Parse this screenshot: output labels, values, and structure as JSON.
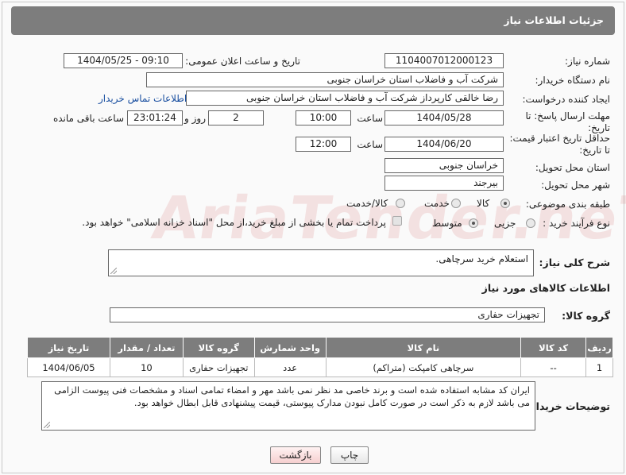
{
  "page_title": "جزئیات اطلاعات نیاز",
  "watermark_text": "AriaTender.neT",
  "fields": {
    "need_number_label": "شماره نیاز:",
    "need_number": "1104007012000123",
    "announce_label": "تاریخ و ساعت اعلان عمومی:",
    "announce_value": "1404/05/25 - 09:10",
    "buyer_org_label": "نام دستگاه خریدار:",
    "buyer_org": "شرکت آب و فاضلاب استان خراسان جنوبی",
    "creator_label": "ایجاد کننده درخواست:",
    "creator": "رضا خالقی کارپرداز شرکت آب و فاضلاب استان خراسان جنوبی",
    "contact_link": "اطلاعات تماس خریدار",
    "reply_deadline_label_1": "مهلت ارسال پاسخ: تا",
    "reply_deadline_label_2": "تاریخ:",
    "reply_date": "1404/05/28",
    "time_label": "ساعت",
    "reply_time": "10:00",
    "days_value": "2",
    "days_label": "روز و",
    "remaining_time": "23:01:24",
    "remaining_label": "ساعت باقی مانده",
    "price_deadline_label_1": "حداقل تاریخ اعتبار قیمت:",
    "price_deadline_label_2": "تا تاریخ:",
    "price_date": "1404/06/20",
    "price_time": "12:00",
    "province_label": "استان محل تحویل:",
    "province": "خراسان جنوبی",
    "city_label": "شهر محل تحویل:",
    "city": "بیرجند",
    "category_label": "طبقه بندی موضوعی:",
    "category_options": [
      "کالا",
      "خدمت",
      "کالا/خدمت"
    ],
    "category_selected": "کالا",
    "process_label": "نوع فرآیند خرید :",
    "process_options": [
      "جزیی",
      "متوسط"
    ],
    "process_selected": "متوسط",
    "payment_note": "پرداخت تمام یا بخشی از مبلغ خرید،از محل \"اسناد خزانه اسلامی\" خواهد بود."
  },
  "description": {
    "label": "شرح کلی نیاز:",
    "text": "استعلام خرید سرچاهی."
  },
  "goods": {
    "section_title": "اطلاعات کالاهای مورد نیاز",
    "group_label": "گروه کالا:",
    "group_value": "تجهیزات حفاری",
    "columns": [
      "ردیف",
      "کد کالا",
      "نام کالا",
      "واحد شمارش",
      "گروه کالا",
      "تعداد / مقدار",
      "تاریخ نیاز"
    ],
    "rows": [
      [
        "1",
        "--",
        "سرچاهی کامپکت (متراکم)",
        "عدد",
        "تجهیزات حفاری",
        "10",
        "1404/06/05"
      ]
    ]
  },
  "buyer_notes": {
    "label": "توضیحات خریدار:",
    "text": "ایران کد مشابه استفاده شده است و برند خاصی مد نظر نمی باشد مهر و امضاء تمامی اسناد و مشخصات فنی پیوست الزامی می باشد لازم به ذکر است در صورت کامل نبودن  مدارک پیوستی،  قیمت پیشنهادی قابل ابطال خواهد بود."
  },
  "buttons": {
    "print": "چاپ",
    "back": "بازگشت"
  }
}
